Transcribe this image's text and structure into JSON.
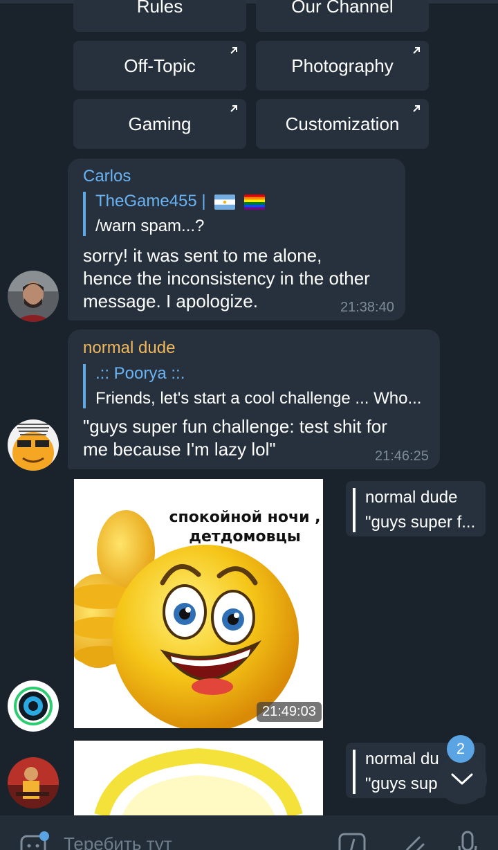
{
  "keyboard": {
    "row0": [
      "Rules",
      "Our Channel"
    ],
    "row1": [
      "Off-Topic",
      "Photography"
    ],
    "row2": [
      "Gaming",
      "Customization"
    ]
  },
  "messages": [
    {
      "sender": "Carlos",
      "sender_color": "#6ab3f3",
      "reply_name": "TheGame455 |",
      "reply_text": "/warn spam...?",
      "lines": [
        "sorry! it was sent to me alone,",
        "hence the inconsistency in the other",
        "message. I apologize."
      ],
      "time": "21:38:40"
    },
    {
      "sender": "normal dude",
      "sender_color": "#f0b85a",
      "reply_name": ".:: Poorya ::.",
      "reply_text": "Friends, let's start a cool challenge ... Who...",
      "lines": [
        "\"guys super fun challenge: test shit for",
        "me because I'm lazy lol\""
      ],
      "time": "21:46:25"
    }
  ],
  "sticker1": {
    "caption_line1": "спокойной ночи ,",
    "caption_line2": "детдомовцы",
    "time": "21:49:03",
    "reply_name": "normal dude",
    "reply_text": "\"guys super f..."
  },
  "sticker2": {
    "reply_name": "normal du",
    "reply_text": "\"guys sup"
  },
  "scroll": {
    "badge": "2"
  },
  "input": {
    "placeholder": "Теребить тут"
  }
}
